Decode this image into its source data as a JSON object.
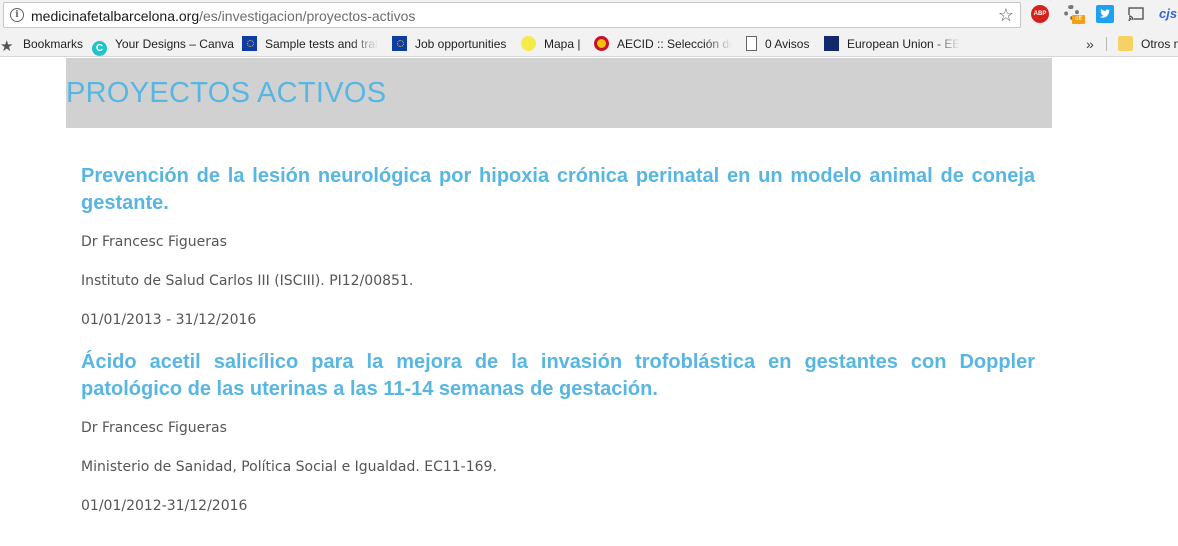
{
  "browser": {
    "url_host": "medicinafetalbarcelona.org",
    "url_path": "/es/investigacion/proyectos-activos",
    "extensions": {
      "abp_label": "ABP",
      "off_badge": "off",
      "cjs_label": "cjs"
    },
    "bookmarks": [
      {
        "label": "Bookmarks",
        "icon": "star-icon"
      },
      {
        "label": "Your Designs – Canva",
        "icon": "canva-icon"
      },
      {
        "label": "Sample tests and trai",
        "icon": "eu-flag-icon"
      },
      {
        "label": "Job opportunities",
        "icon": "eu-flag-icon"
      },
      {
        "label": "Mapa |",
        "icon": "map-icon"
      },
      {
        "label": "AECID :: Selección de",
        "icon": "aecid-icon"
      },
      {
        "label": "0 Avisos",
        "icon": "document-icon"
      },
      {
        "label": "European Union - EEA",
        "icon": "eu-hub-icon"
      },
      {
        "label": "Otros m",
        "icon": "folder-icon"
      }
    ],
    "overflow_label": "»"
  },
  "page": {
    "title": "PROYECTOS ACTIVOS",
    "projects": [
      {
        "title": "Prevención de la lesión neurológica por hipoxia crónica perinatal en un modelo animal de coneja gestante.",
        "investigator": "Dr Francesc Figueras",
        "funding": "Instituto de Salud Carlos III (ISCIII). PI12/00851.",
        "dates": "01/01/2013 - 31/12/2016"
      },
      {
        "title": "Ácido acetil salicílico para la mejora de la invasión trofoblástica en gestantes con Doppler patológico de las uterinas a las 11-14 semanas de gestación.",
        "investigator": "Dr Francesc Figueras",
        "funding": "Ministerio de Sanidad, Política Social e Igualdad. EC11-169.",
        "dates": "01/01/2012-31/12/2016"
      }
    ]
  },
  "colors": {
    "accent": "#57b6e2",
    "banner_bg": "#d1d1d1",
    "body_text": "#555555"
  }
}
